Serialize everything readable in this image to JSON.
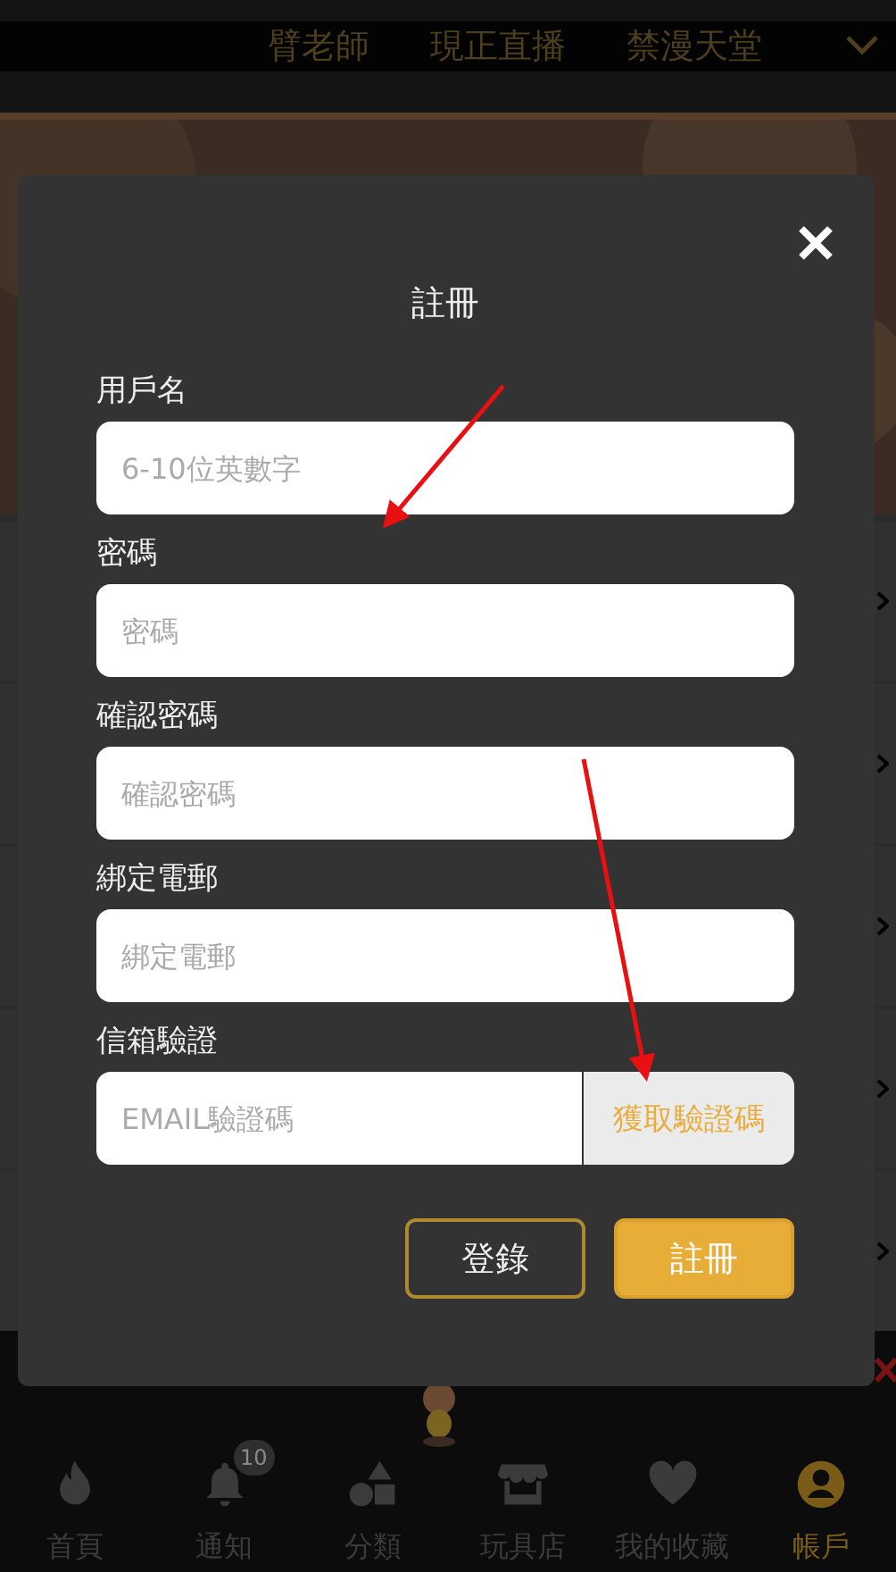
{
  "top_nav": {
    "tabs": [
      {
        "label": "臂老師",
        "selected": false
      },
      {
        "label": "現正直播",
        "selected": false
      },
      {
        "label": "禁漫天堂",
        "selected": false
      }
    ]
  },
  "modal": {
    "title": "註冊",
    "fields": [
      {
        "label": "用戶名",
        "placeholder": "6-10位英數字"
      },
      {
        "label": "密碼",
        "placeholder": "密碼"
      },
      {
        "label": "確認密碼",
        "placeholder": "確認密碼"
      },
      {
        "label": "綁定電郵",
        "placeholder": "綁定電郵"
      },
      {
        "label": "信箱驗證",
        "placeholder": "EMAIL驗證碼",
        "button": "獲取驗證碼"
      }
    ],
    "buttons": [
      {
        "label": "登錄",
        "kind": "outline"
      },
      {
        "label": "註冊",
        "kind": "primary"
      }
    ]
  },
  "bottom_nav": {
    "items": [
      {
        "label": "首頁",
        "kind": "fire",
        "selected": false
      },
      {
        "label": "通知",
        "kind": "bell",
        "badge": "10",
        "selected": false
      },
      {
        "label": "分類",
        "kind": "shapes",
        "selected": false
      },
      {
        "label": "玩具店",
        "kind": "store",
        "selected": false
      },
      {
        "label": "我的收藏",
        "kind": "heart",
        "selected": false
      },
      {
        "label": "帳戶",
        "kind": "user",
        "selected": true
      }
    ]
  }
}
